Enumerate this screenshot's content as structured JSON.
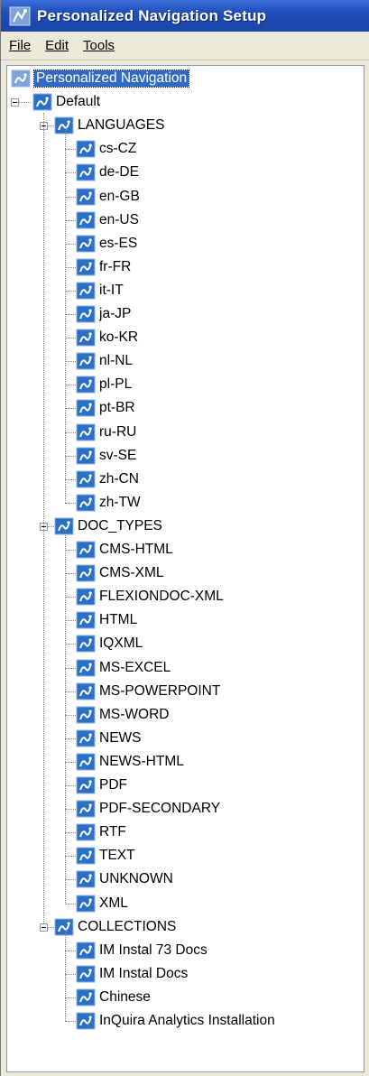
{
  "window": {
    "title": "Personalized Navigation Setup",
    "title_icon": "app-icon"
  },
  "menu": {
    "file": "File",
    "edit": "Edit",
    "tools": "Tools"
  },
  "tree": {
    "root": "Personalized Navigation",
    "default": "Default",
    "languages": {
      "label": "LANGUAGES",
      "items": [
        "cs-CZ",
        "de-DE",
        "en-GB",
        "en-US",
        "es-ES",
        "fr-FR",
        "it-IT",
        "ja-JP",
        "ko-KR",
        "nl-NL",
        "pl-PL",
        "pt-BR",
        "ru-RU",
        "sv-SE",
        "zh-CN",
        "zh-TW"
      ]
    },
    "doc_types": {
      "label": "DOC_TYPES",
      "items": [
        "CMS-HTML",
        "CMS-XML",
        "FLEXIONDOC-XML",
        "HTML",
        "IQXML",
        "MS-EXCEL",
        "MS-POWERPOINT",
        "MS-WORD",
        "NEWS",
        "NEWS-HTML",
        "PDF",
        "PDF-SECONDARY",
        "RTF",
        "TEXT",
        "UNKNOWN",
        "XML"
      ]
    },
    "collections": {
      "label": "COLLECTIONS",
      "items": [
        "IM Instal 73 Docs",
        "IM Instal Docs",
        "Chinese",
        "InQuira Analytics Installation"
      ]
    }
  },
  "colors": {
    "titlebar": "#1f4fb8",
    "selection": "#316ac5",
    "node_icon": "#2b6fc7"
  }
}
